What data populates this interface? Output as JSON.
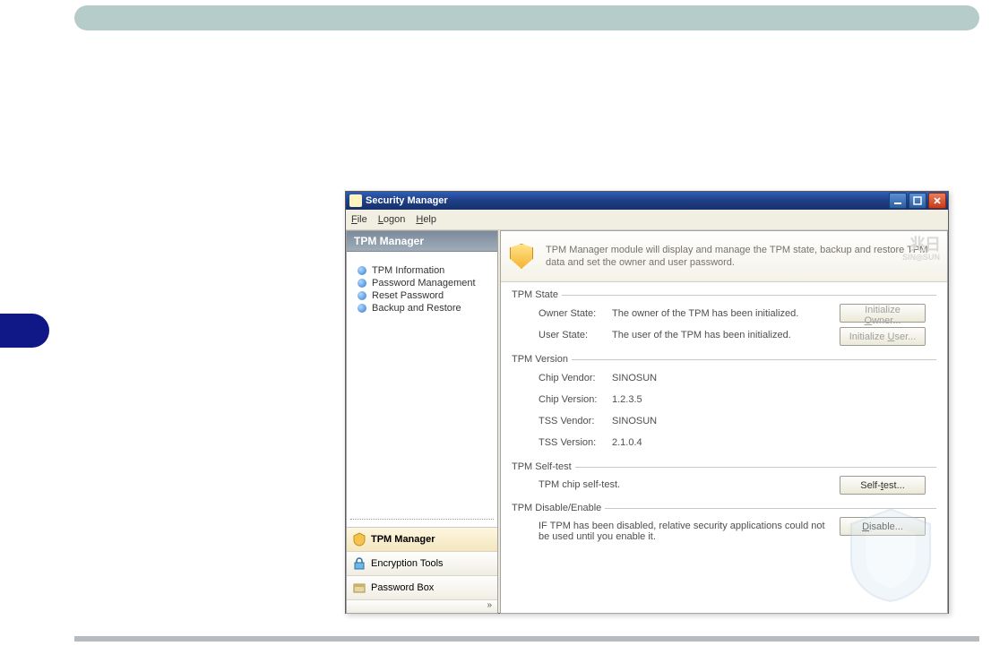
{
  "titlebar": {
    "title": "Security Manager"
  },
  "menubar": {
    "file": "File",
    "logon": "Logon",
    "help": "Help"
  },
  "sidebar": {
    "header": "TPM Manager",
    "tree": [
      "TPM Information",
      "Password Management",
      "Reset Password",
      "Backup and Restore"
    ],
    "bottom": {
      "tpm": "TPM Manager",
      "encryption": "Encryption Tools",
      "passwordbox": "Password Box"
    }
  },
  "banner": {
    "text": "TPM Manager module will display and manage the TPM state, backup and restore TPM data and set the owner and user password.",
    "logo_top": "兆日",
    "logo_bot": "SIN◎SUN"
  },
  "panel": {
    "state": {
      "heading": "TPM State",
      "owner_label": "Owner State:",
      "owner_value": "The owner of the TPM has been initialized.",
      "user_label": "User State:",
      "user_value": "The user of the TPM has been initialized.",
      "init_owner_btn": "Initialize Owner...",
      "init_user_btn": "Initialize User..."
    },
    "version": {
      "heading": "TPM Version",
      "chip_vendor_label": "Chip Vendor:",
      "chip_vendor_value": "SINOSUN",
      "chip_version_label": "Chip Version:",
      "chip_version_value": "1.2.3.5",
      "tss_vendor_label": "TSS Vendor:",
      "tss_vendor_value": "SINOSUN",
      "tss_version_label": "TSS Version:",
      "tss_version_value": "2.1.0.4"
    },
    "selftest": {
      "heading": "TPM Self-test",
      "desc": "TPM chip self-test.",
      "btn": "Self-test..."
    },
    "disable": {
      "heading": "TPM Disable/Enable",
      "desc": "IF TPM has been disabled, relative security applications could not be used until you enable it.",
      "btn": "Disable..."
    }
  }
}
